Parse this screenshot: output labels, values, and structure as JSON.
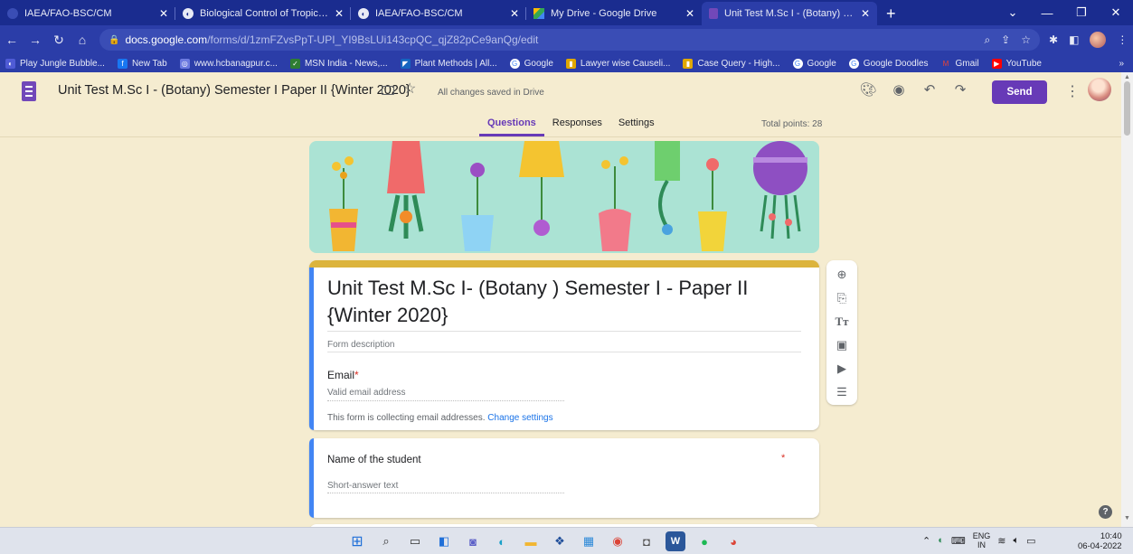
{
  "browser": {
    "tabs": [
      {
        "title": "IAEA/FAO-BSC/CM",
        "icon": "page-icon",
        "active": false
      },
      {
        "title": "Biological Control of Tropical We",
        "icon": "globe-icon",
        "active": false
      },
      {
        "title": "IAEA/FAO-BSC/CM",
        "icon": "globe-icon",
        "active": false
      },
      {
        "title": "My Drive - Google Drive",
        "icon": "drive-icon",
        "active": false
      },
      {
        "title": "Unit Test M.Sc I - (Botany) Semes",
        "icon": "forms-icon",
        "active": true
      }
    ],
    "url_host": "docs.google.com",
    "url_path": "/forms/d/1zmFZvsPpT-UPI_YI9BsLUi143cpQC_qjZ82pCe9anQg/edit",
    "bookmarks": [
      {
        "label": "Play Jungle Bubble...",
        "color": "#4f5bd5"
      },
      {
        "label": "New Tab",
        "color": "#1877f2"
      },
      {
        "label": "www.hcbanagpur.c...",
        "color": "#6c7ae0"
      },
      {
        "label": "MSN India - News,...",
        "color": "#2e7d32"
      },
      {
        "label": "Plant Methods | All...",
        "color": "#1565c0"
      },
      {
        "label": "Google",
        "color": "#fafafa"
      },
      {
        "label": "Lawyer wise Causeli...",
        "color": "#e0a800"
      },
      {
        "label": "Case Query - High...",
        "color": "#e0a800"
      },
      {
        "label": "Google",
        "color": "#fafafa"
      },
      {
        "label": "Google Doodles",
        "color": "#fafafa"
      },
      {
        "label": "Gmail",
        "color": "#d93025"
      },
      {
        "label": "YouTube",
        "color": "#ff0000"
      }
    ],
    "bookmarks_more": "»"
  },
  "header": {
    "doc_title": "Unit Test M.Sc I - (Botany) Semester I Paper II {Winter 2020}",
    "saved_status": "All changes saved in Drive",
    "send_label": "Send",
    "tabs": [
      "Questions",
      "Responses",
      "Settings"
    ],
    "total_points": "Total points: 28"
  },
  "form": {
    "title": "Unit Test M.Sc I- (Botany ) Semester I - Paper II {Winter 2020}",
    "description_placeholder": "Form description",
    "email_label": "Email",
    "required_mark": "*",
    "email_placeholder": "Valid email address",
    "collect_text": "This form is collecting email addresses.",
    "change_settings": "Change settings",
    "question1_title": "Name of the student",
    "question1_placeholder": "Short-answer text",
    "help_label": "?"
  },
  "taskbar": {
    "lang_top": "ENG",
    "lang_bottom": "IN",
    "time": "10:40",
    "date": "06-04-2022"
  },
  "colors": {
    "accent": "#673ab7",
    "theme_bg": "#f5ecd0",
    "title_bar": "#dcb43c",
    "browser_frame": "#1a2c8f"
  }
}
